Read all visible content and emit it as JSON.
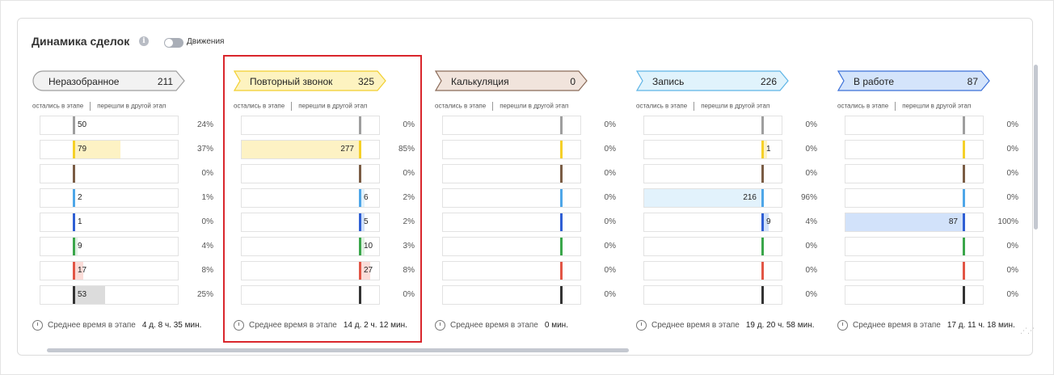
{
  "header": {
    "title": "Динамика сделок",
    "toggle_label": "Движения"
  },
  "labels": {
    "stayed": "остались в этапе",
    "moved": "перешли в другой этап",
    "avg_time": "Среднее время в этапе"
  },
  "colors": {
    "row_marks": [
      "#9e9e9e",
      "#f5d028",
      "#7a5c44",
      "#4ea6e8",
      "#2f5fd4",
      "#3aa64a",
      "#e25545",
      "#333333"
    ],
    "stayed_fills": [
      "#ffffff",
      "#fdf2c4",
      "#ffffff",
      "#e2f2fc",
      "#d2e2fa",
      "#e0f1e2",
      "#fbdcd8",
      "#dcdcdc"
    ],
    "highlight": "#d9262c"
  },
  "stages": [
    {
      "name": "Неразобранное",
      "count": "211",
      "fill": "#f2f2f2",
      "stroke": "#9e9e9e",
      "avg_time": "4 д. 8 ч. 35 мин.",
      "rows": [
        {
          "stayed": "50",
          "stayed_frac": 0.24,
          "moved": "",
          "moved_frac": 0,
          "pct": "24%"
        },
        {
          "stayed": "79",
          "stayed_frac": 0.37,
          "moved": "",
          "moved_frac": 0,
          "pct": "37%"
        },
        {
          "stayed": "",
          "stayed_frac": 0,
          "moved": "",
          "moved_frac": 0,
          "pct": "0%"
        },
        {
          "stayed": "2",
          "stayed_frac": 0.01,
          "moved": "",
          "moved_frac": 0,
          "pct": "1%"
        },
        {
          "stayed": "1",
          "stayed_frac": 0.005,
          "moved": "",
          "moved_frac": 0,
          "pct": "0%"
        },
        {
          "stayed": "9",
          "stayed_frac": 0.04,
          "moved": "",
          "moved_frac": 0,
          "pct": "4%"
        },
        {
          "stayed": "17",
          "stayed_frac": 0.08,
          "moved": "",
          "moved_frac": 0,
          "pct": "8%"
        },
        {
          "stayed": "53",
          "stayed_frac": 0.25,
          "moved": "",
          "moved_frac": 0,
          "pct": "25%"
        }
      ]
    },
    {
      "name": "Повторный звонок",
      "count": "325",
      "fill": "#fdf3c0",
      "stroke": "#f2cf2e",
      "avg_time": "14 д. 2 ч. 12 мин.",
      "rows": [
        {
          "stayed": "",
          "stayed_frac": 0,
          "moved": "",
          "moved_frac": 0,
          "pct": "0%"
        },
        {
          "stayed": "277",
          "stayed_frac": 0.85,
          "moved": "",
          "moved_frac": 0,
          "pct": "85%"
        },
        {
          "stayed": "",
          "stayed_frac": 0,
          "moved": "",
          "moved_frac": 0,
          "pct": "0%"
        },
        {
          "stayed": "",
          "stayed_frac": 0,
          "moved": "6",
          "moved_frac": 0.02,
          "pct": "2%"
        },
        {
          "stayed": "",
          "stayed_frac": 0,
          "moved": "5",
          "moved_frac": 0.02,
          "pct": "2%"
        },
        {
          "stayed": "",
          "stayed_frac": 0,
          "moved": "10",
          "moved_frac": 0.03,
          "pct": "3%"
        },
        {
          "stayed": "",
          "stayed_frac": 0,
          "moved": "27",
          "moved_frac": 0.08,
          "pct": "8%"
        },
        {
          "stayed": "",
          "stayed_frac": 0,
          "moved": "",
          "moved_frac": 0,
          "pct": "0%"
        }
      ]
    },
    {
      "name": "Калькуляция",
      "count": "0",
      "fill": "#f1e4dc",
      "stroke": "#8a6a58",
      "avg_time": "0 мин.",
      "rows": [
        {
          "stayed": "",
          "stayed_frac": 0,
          "moved": "",
          "moved_frac": 0,
          "pct": "0%"
        },
        {
          "stayed": "",
          "stayed_frac": 0,
          "moved": "",
          "moved_frac": 0,
          "pct": "0%"
        },
        {
          "stayed": "",
          "stayed_frac": 0,
          "moved": "",
          "moved_frac": 0,
          "pct": "0%"
        },
        {
          "stayed": "",
          "stayed_frac": 0,
          "moved": "",
          "moved_frac": 0,
          "pct": "0%"
        },
        {
          "stayed": "",
          "stayed_frac": 0,
          "moved": "",
          "moved_frac": 0,
          "pct": "0%"
        },
        {
          "stayed": "",
          "stayed_frac": 0,
          "moved": "",
          "moved_frac": 0,
          "pct": "0%"
        },
        {
          "stayed": "",
          "stayed_frac": 0,
          "moved": "",
          "moved_frac": 0,
          "pct": "0%"
        },
        {
          "stayed": "",
          "stayed_frac": 0,
          "moved": "",
          "moved_frac": 0,
          "pct": "0%"
        }
      ]
    },
    {
      "name": "Запись",
      "count": "226",
      "fill": "#e0f3fc",
      "stroke": "#5db4e6",
      "avg_time": "19 д. 20 ч. 58 мин.",
      "rows": [
        {
          "stayed": "",
          "stayed_frac": 0,
          "moved": "",
          "moved_frac": 0,
          "pct": "0%"
        },
        {
          "stayed": "",
          "stayed_frac": 0,
          "moved": "1",
          "moved_frac": 0.005,
          "pct": "0%"
        },
        {
          "stayed": "",
          "stayed_frac": 0,
          "moved": "",
          "moved_frac": 0,
          "pct": "0%"
        },
        {
          "stayed": "216",
          "stayed_frac": 0.96,
          "moved": "",
          "moved_frac": 0,
          "pct": "96%"
        },
        {
          "stayed": "",
          "stayed_frac": 0,
          "moved": "9",
          "moved_frac": 0.04,
          "pct": "4%"
        },
        {
          "stayed": "",
          "stayed_frac": 0,
          "moved": "",
          "moved_frac": 0,
          "pct": "0%"
        },
        {
          "stayed": "",
          "stayed_frac": 0,
          "moved": "",
          "moved_frac": 0,
          "pct": "0%"
        },
        {
          "stayed": "",
          "stayed_frac": 0,
          "moved": "",
          "moved_frac": 0,
          "pct": "0%"
        }
      ]
    },
    {
      "name": "В работе",
      "count": "87",
      "fill": "#d4e4fb",
      "stroke": "#3a6fd8",
      "avg_time": "17 д. 11 ч. 18 мин.",
      "rows": [
        {
          "stayed": "",
          "stayed_frac": 0,
          "moved": "",
          "moved_frac": 0,
          "pct": "0%"
        },
        {
          "stayed": "",
          "stayed_frac": 0,
          "moved": "",
          "moved_frac": 0,
          "pct": "0%"
        },
        {
          "stayed": "",
          "stayed_frac": 0,
          "moved": "",
          "moved_frac": 0,
          "pct": "0%"
        },
        {
          "stayed": "",
          "stayed_frac": 0,
          "moved": "",
          "moved_frac": 0,
          "pct": "0%"
        },
        {
          "stayed": "87",
          "stayed_frac": 1.0,
          "moved": "",
          "moved_frac": 0,
          "pct": "100%"
        },
        {
          "stayed": "",
          "stayed_frac": 0,
          "moved": "",
          "moved_frac": 0,
          "pct": "0%"
        },
        {
          "stayed": "",
          "stayed_frac": 0,
          "moved": "",
          "moved_frac": 0,
          "pct": "0%"
        },
        {
          "stayed": "",
          "stayed_frac": 0,
          "moved": "",
          "moved_frac": 0,
          "pct": "0%"
        }
      ]
    }
  ]
}
